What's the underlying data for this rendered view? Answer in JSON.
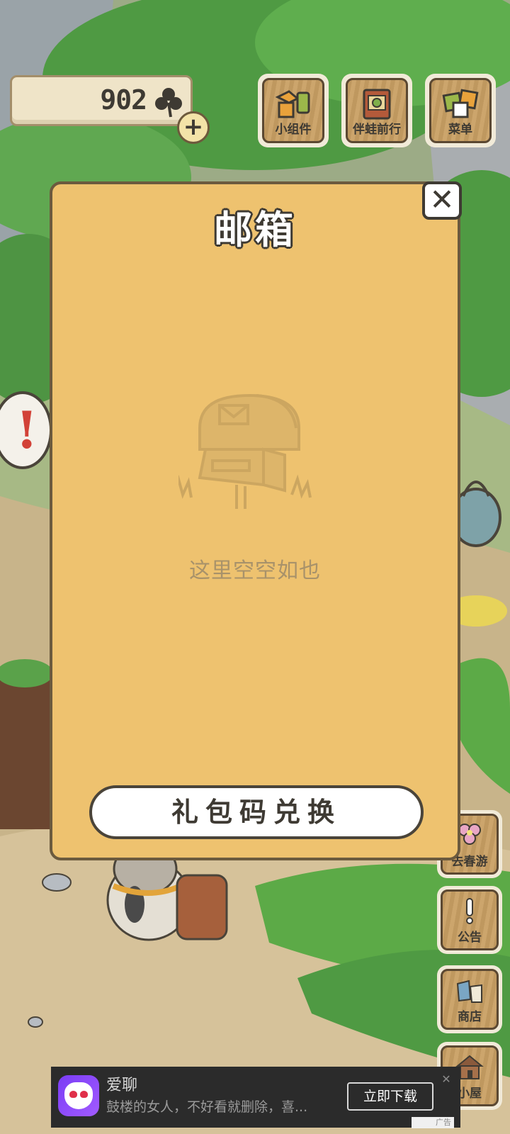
{
  "top_bar": {
    "clover_count": "902",
    "clover_icon": "clover-icon",
    "add_icon": "plus-icon",
    "buttons": [
      {
        "label": "小组件",
        "icon": "widget-icon"
      },
      {
        "label": "伴蛙前行",
        "icon": "travel-book-icon"
      },
      {
        "label": "菜单",
        "icon": "menu-cards-icon"
      }
    ]
  },
  "mailbox_dialog": {
    "title": "邮箱",
    "close_icon": "close-icon",
    "empty_illustration": "mailbox-icon",
    "empty_message": "这里空空如也",
    "redeem_button": "礼包码兑换"
  },
  "alert_icon": "exclamation-icon",
  "side_buttons": [
    {
      "label": "去春游",
      "icon": "flower-icon"
    },
    {
      "label": "公告",
      "icon": "exclamation-icon"
    },
    {
      "label": "商店",
      "icon": "shop-bags-icon"
    },
    {
      "label": "小屋",
      "icon": "house-icon"
    }
  ],
  "ad": {
    "app_name": "爱聊",
    "description": "鼓楼的女人，不好看就删除，喜...",
    "cta": "立即下载",
    "tag": "广告"
  },
  "colors": {
    "dialog_bg": "#eec26f",
    "dialog_border": "#6b5a3e",
    "button_wood": "#c9a064",
    "alert_red": "#d24238"
  }
}
